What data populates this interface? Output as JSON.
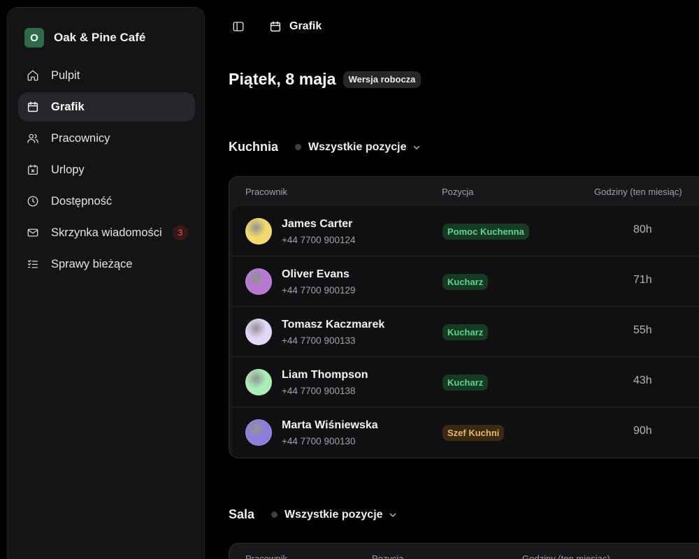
{
  "brand": {
    "initial": "O",
    "name": "Oak & Pine Café"
  },
  "sidebar": {
    "items": [
      {
        "label": "Pulpit",
        "icon": "home-icon",
        "active": false
      },
      {
        "label": "Grafik",
        "icon": "calendar-icon",
        "active": true
      },
      {
        "label": "Pracownicy",
        "icon": "users-icon",
        "active": false
      },
      {
        "label": "Urlopy",
        "icon": "calendar-x-icon",
        "active": false
      },
      {
        "label": "Dostępność",
        "icon": "clock-icon",
        "active": false
      },
      {
        "label": "Skrzynka wiadomości",
        "icon": "mail-icon",
        "active": false,
        "badge": "3"
      },
      {
        "label": "Sprawy bieżące",
        "icon": "checklist-icon",
        "active": false
      }
    ]
  },
  "topbar": {
    "breadcrumb": "Grafik"
  },
  "page": {
    "title": "Piątek, 8 maja",
    "status": "Wersja robocza"
  },
  "sections": [
    {
      "title": "Kuchnia",
      "filter": "Wszystkie pozycje",
      "columns": {
        "employee": "Pracownik",
        "position": "Pozycja",
        "hours": "Godziny (ten miesiąc)"
      },
      "rows": [
        {
          "name": "James Carter",
          "phone": "+44 7700 900124",
          "position": "Pomoc Kuchenna",
          "hours": "80h",
          "avatar_color": "#f2d96b",
          "badge_bg": "#163a24",
          "badge_fg": "#5fd48a"
        },
        {
          "name": "Oliver Evans",
          "phone": "+44 7700 900129",
          "position": "Kucharz",
          "hours": "71h",
          "avatar_color": "#b978d6",
          "badge_bg": "#163a24",
          "badge_fg": "#5fd48a"
        },
        {
          "name": "Tomasz Kaczmarek",
          "phone": "+44 7700 900133",
          "position": "Kucharz",
          "hours": "55h",
          "avatar_color": "#e3d6f6",
          "badge_bg": "#163a24",
          "badge_fg": "#5fd48a"
        },
        {
          "name": "Liam Thompson",
          "phone": "+44 7700 900138",
          "position": "Kucharz",
          "hours": "43h",
          "avatar_color": "#a9eeb6",
          "badge_bg": "#163a24",
          "badge_fg": "#5fd48a"
        },
        {
          "name": "Marta Wiśniewska",
          "phone": "+44 7700 900130",
          "position": "Szef Kuchni",
          "hours": "90h",
          "avatar_color": "#8c7fdc",
          "badge_bg": "#3a2a14",
          "badge_fg": "#e6b66b"
        }
      ]
    },
    {
      "title": "Sala",
      "filter": "Wszystkie pozycje",
      "columns": {
        "employee": "Pracownik",
        "position": "Pozycja",
        "hours": "Godziny (ten miesiąc)"
      },
      "rows": []
    }
  ]
}
